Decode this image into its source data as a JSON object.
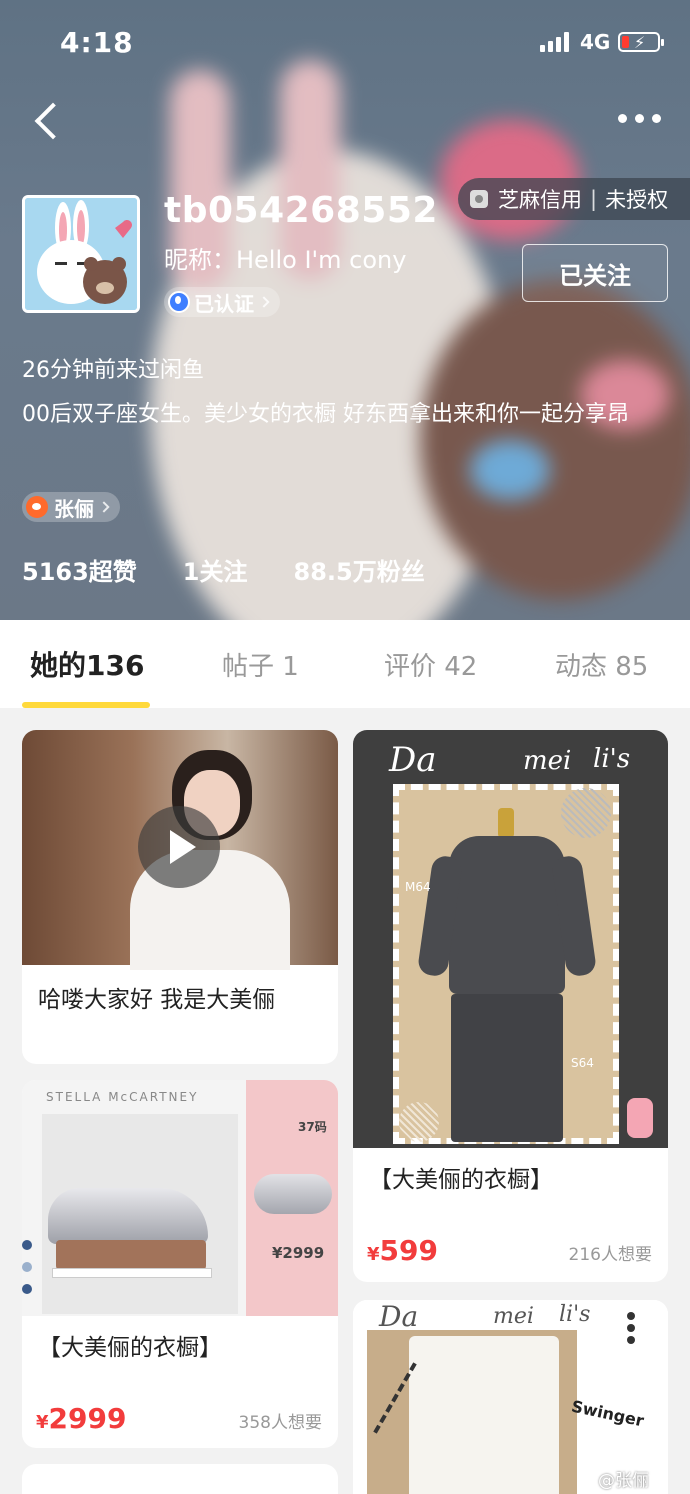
{
  "status_bar": {
    "time": "4:18",
    "network": "4G"
  },
  "profile": {
    "credit_label": "芝麻信用",
    "credit_status": "未授权",
    "user_id": "tb054268552",
    "nickname": "昵称：Hello I'm cony",
    "verified_label": "已认证",
    "follow_label": "已关注",
    "last_visit": "26分钟前来过闲鱼",
    "bio": "00后双子座女生。美少女的衣橱 好东西拿出来和你一起分享昂",
    "weibo_name": "张俪",
    "stats": {
      "likes": "5163超赞",
      "following": "1关注",
      "fans": "88.5万粉丝"
    }
  },
  "tabs": [
    {
      "label": "她的136",
      "active": true
    },
    {
      "label": "帖子 1",
      "active": false
    },
    {
      "label": "评价 42",
      "active": false
    },
    {
      "label": "动态 85",
      "active": false
    }
  ],
  "items": [
    {
      "title": "哈喽大家好 我是大美俪",
      "type": "video"
    },
    {
      "title": "【大美俪的衣橱】",
      "price": "599",
      "wants": "216人想要",
      "image_text": [
        "Da",
        "mei",
        "li's",
        "M64",
        "S64"
      ]
    },
    {
      "title": "【大美俪的衣橱】",
      "price": "2999",
      "wants": "358人想要",
      "image_text": [
        "STELLA McCARTNEY",
        "37码",
        "¥2999"
      ]
    },
    {
      "title": "",
      "image_text": [
        "Da",
        "mei",
        "li's",
        "Swinger"
      ]
    }
  ],
  "currency": "¥",
  "watermark": "@张俪",
  "colors": {
    "accent": "#ffd93b",
    "price": "#f23c3c",
    "header_bg": "#64778a"
  }
}
